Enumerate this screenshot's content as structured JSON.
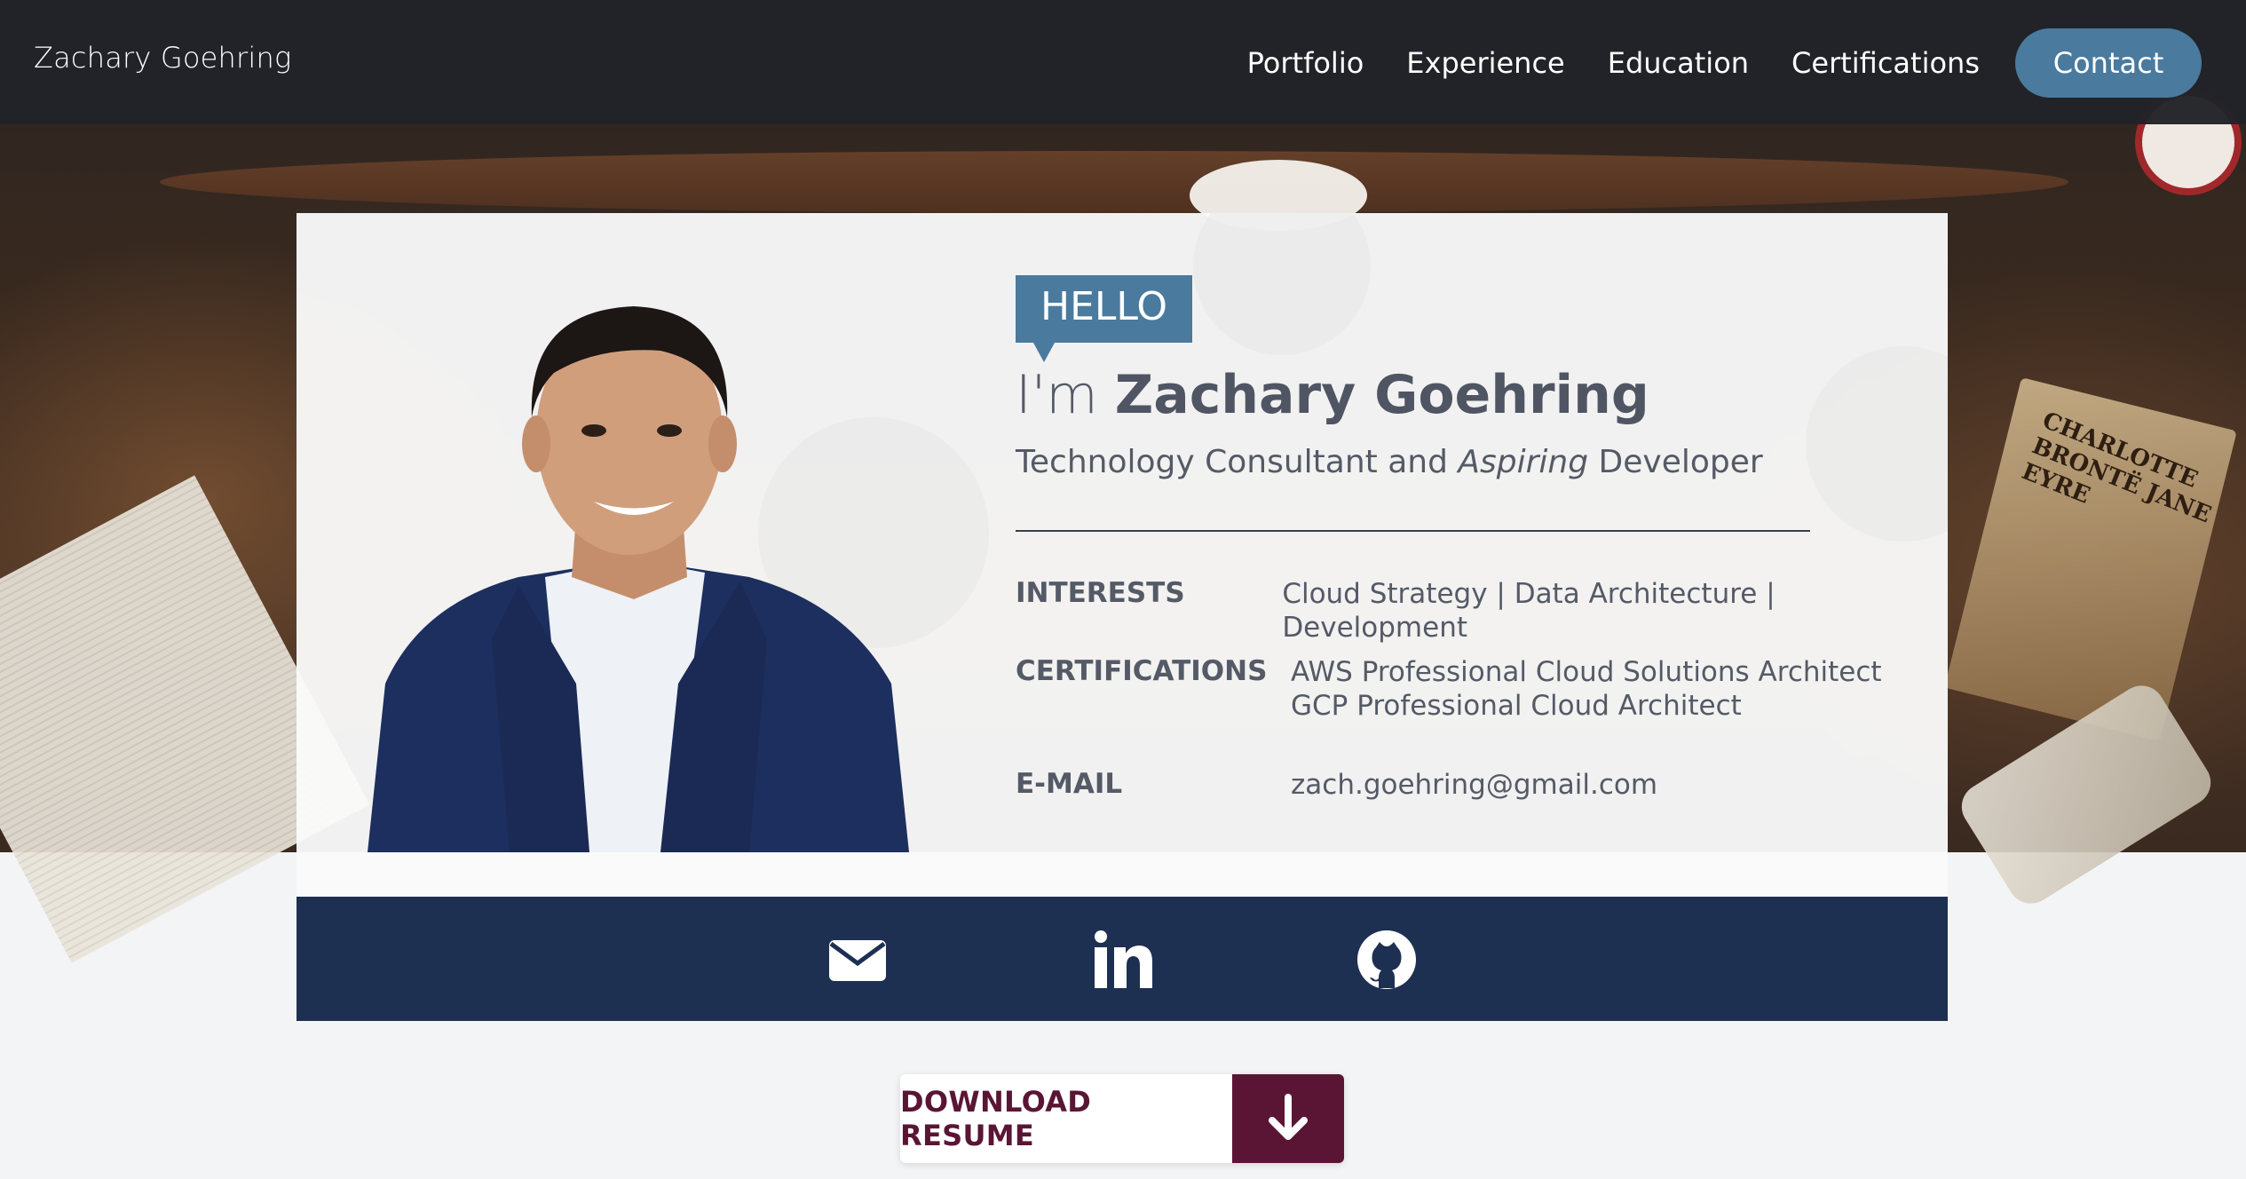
{
  "nav": {
    "brand": "Zachary Goehring",
    "links": [
      "Portfolio",
      "Experience",
      "Education",
      "Certifications"
    ],
    "contact": "Contact"
  },
  "hero": {
    "hello": "HELLO",
    "im": "I'm ",
    "name": "Zachary Goehring",
    "tagline_pre": "Technology Consultant and ",
    "tagline_em": "Aspiring",
    "tagline_post": " Developer",
    "background_book_text": "CHARLOTTE BRONTË JANE EYRE"
  },
  "info": [
    {
      "label": "INTERESTS",
      "values": [
        "Cloud Strategy | Data Architecture | Development"
      ]
    },
    {
      "label": "CERTIFICATIONS",
      "values": [
        "AWS Professional Cloud Solutions Architect",
        "GCP Professional Cloud Architect"
      ]
    },
    {
      "label": "E-MAIL",
      "values": [
        "zach.goehring@gmail.com"
      ]
    }
  ],
  "social": [
    {
      "icon": "envelope-icon"
    },
    {
      "icon": "linkedin-icon"
    },
    {
      "icon": "github-icon"
    }
  ],
  "download": {
    "label": "DOWNLOAD RESUME",
    "icon": "arrow-down-icon"
  },
  "colors": {
    "navbar": "#212328",
    "accent": "#4a7a9e",
    "social_bar": "#1e3052",
    "download_accent": "#5a1535",
    "text": "#545a66"
  }
}
